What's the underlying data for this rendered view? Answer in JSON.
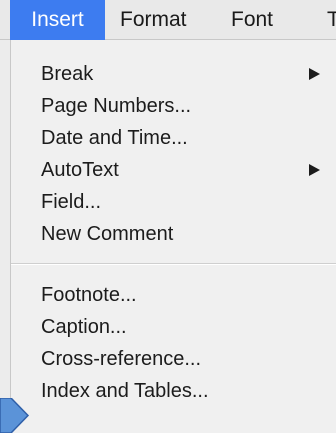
{
  "menubar": {
    "items": [
      {
        "label": "Insert",
        "active": true
      },
      {
        "label": "Format"
      },
      {
        "label": "Font"
      },
      {
        "label": "T"
      }
    ]
  },
  "dropdown": {
    "group1": [
      {
        "label": "Break",
        "submenu": true
      },
      {
        "label": "Page Numbers..."
      },
      {
        "label": "Date and Time..."
      },
      {
        "label": "AutoText",
        "submenu": true
      },
      {
        "label": "Field..."
      },
      {
        "label": "New Comment"
      }
    ],
    "group2": [
      {
        "label": "Footnote..."
      },
      {
        "label": "Caption..."
      },
      {
        "label": "Cross-reference..."
      },
      {
        "label": "Index and Tables..."
      }
    ]
  },
  "icons": {
    "submenu_arrow": "triangle-right-icon",
    "pointer": "callout-arrow-icon"
  },
  "colors": {
    "active_menu_bg": "#3d7cf0",
    "pointer_blue": "#5b93d8"
  }
}
